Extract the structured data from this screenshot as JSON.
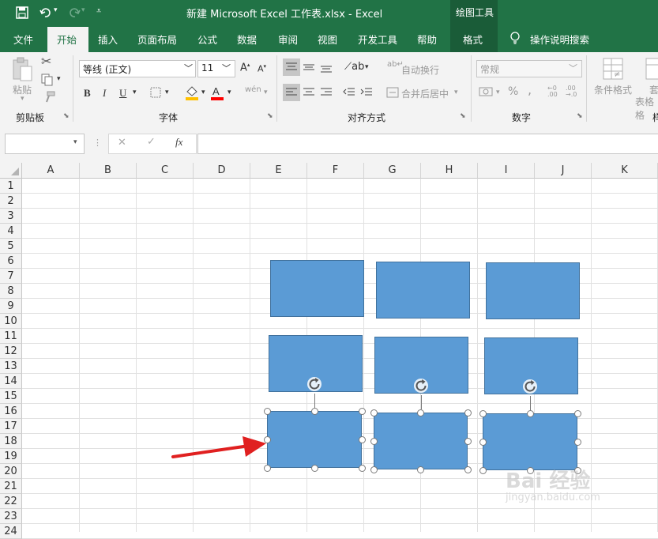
{
  "titlebar": {
    "title": "新建 Microsoft Excel 工作表.xlsx  -  Excel",
    "context_group": "绘图工具"
  },
  "tabs": [
    {
      "label": "文件"
    },
    {
      "label": "开始"
    },
    {
      "label": "插入"
    },
    {
      "label": "页面布局"
    },
    {
      "label": "公式"
    },
    {
      "label": "数据"
    },
    {
      "label": "审阅"
    },
    {
      "label": "视图"
    },
    {
      "label": "开发工具"
    },
    {
      "label": "帮助"
    },
    {
      "label": "格式"
    }
  ],
  "tell_me": "操作说明搜索",
  "ribbon": {
    "clipboard": {
      "paste": "粘贴",
      "group": "剪贴板"
    },
    "font": {
      "name": "等线 (正文)",
      "size": "11",
      "bold": "B",
      "italic": "I",
      "underline": "U",
      "group": "字体",
      "phonetic": "wén"
    },
    "alignment": {
      "wrap": "自动换行",
      "merge": "合并后居中",
      "group": "对齐方式"
    },
    "number": {
      "format": "常规",
      "percent": "%",
      "comma": ",",
      "group": "数字"
    },
    "styles": {
      "conditional": "条件格式",
      "table_a": "套",
      "table_b": "表格格",
      "group": "样"
    }
  },
  "formula_bar": {
    "fx": "fx",
    "cancel": "✕",
    "enter": "✓"
  },
  "columns": [
    "A",
    "B",
    "C",
    "D",
    "E",
    "F",
    "G",
    "H",
    "I",
    "J",
    "K"
  ],
  "rows": [
    "1",
    "2",
    "3",
    "4",
    "5",
    "6",
    "7",
    "8",
    "9",
    "10",
    "11",
    "12",
    "13",
    "14",
    "15",
    "16",
    "17",
    "18",
    "19",
    "20",
    "21",
    "22",
    "23",
    "24"
  ],
  "colors": {
    "excel_green": "#217346",
    "shape_fill": "#5b9bd5",
    "shape_border": "#41719c",
    "arrow": "#e02020"
  },
  "watermark": {
    "brand": "Bai 经验",
    "url": "jingyan.baidu.com"
  }
}
